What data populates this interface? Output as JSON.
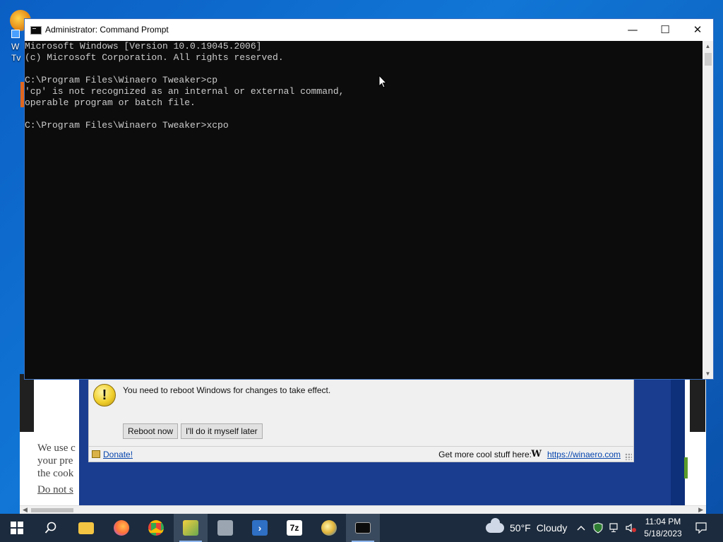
{
  "desktop": {
    "icon_text": "W\nTv"
  },
  "background_page": {
    "cookie_lines": [
      "We use c",
      "your pre",
      "the cook"
    ],
    "cookie_link": "Do not s"
  },
  "cmd": {
    "title": "Administrator:  Command Prompt",
    "minimize_glyph": "—",
    "maximize_glyph": "☐",
    "close_glyph": "✕",
    "lines": [
      "Microsoft Windows [Version 10.0.19045.2006]",
      "(c) Microsoft Corporation. All rights reserved.",
      "",
      "C:\\Program Files\\Winaero Tweaker>cp",
      "'cp' is not recognized as an internal or external command,",
      "operable program or batch file.",
      "",
      "C:\\Program Files\\Winaero Tweaker>xcpo"
    ]
  },
  "tweaker": {
    "message": "You need to reboot Windows for changes to take effect.",
    "reboot_button": "Reboot now",
    "later_button": "I'll do it myself later",
    "donate": "Donate!",
    "get_more": "Get more cool stuff here:",
    "w_glyph": "W",
    "site_link": "https://winaero.com"
  },
  "taskbar": {
    "items": [
      {
        "name": "start-button-icon",
        "color": "#ffffff"
      },
      {
        "name": "search-icon",
        "color": "#ffffff"
      },
      {
        "name": "file-explorer-icon",
        "color": "#f4c542"
      },
      {
        "name": "firefox-icon",
        "color": "#ff7139"
      },
      {
        "name": "chrome-icon",
        "color": "#34a853"
      },
      {
        "name": "winaero-tweaker-icon",
        "color": "#6aa84f"
      },
      {
        "name": "app-icon",
        "color": "#9aa5b1"
      },
      {
        "name": "powershell-icon",
        "color": "#2f6fc4"
      },
      {
        "name": "7zip-icon",
        "color": "#ffffff"
      },
      {
        "name": "browser-icon",
        "color": "#e0b43a"
      },
      {
        "name": "command-prompt-icon",
        "color": "#0c0c0c"
      }
    ],
    "weather_temp": "50°F",
    "weather_desc": "Cloudy",
    "time": "11:04 PM",
    "date": "5/18/2023"
  }
}
